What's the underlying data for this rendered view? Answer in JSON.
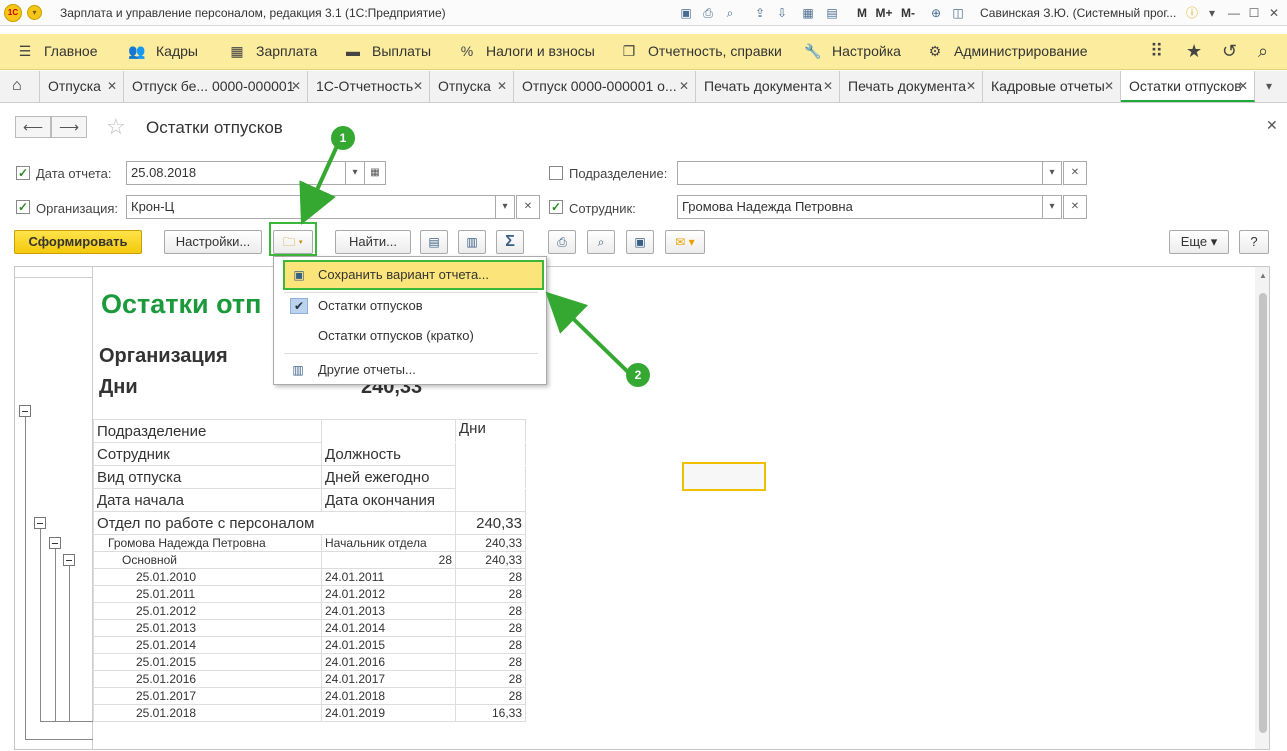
{
  "window": {
    "title": "Зарплата и управление персоналом, редакция 3.1  (1С:Предприятие)",
    "user": "Савинская З.Ю. (Системный прог..."
  },
  "menu": [
    {
      "icon": "hamburger-icon",
      "label": "Главное"
    },
    {
      "icon": "people-icon",
      "label": "Кадры"
    },
    {
      "icon": "calculator-icon",
      "label": "Зарплата"
    },
    {
      "icon": "wallet-icon",
      "label": "Выплаты"
    },
    {
      "icon": "percent-icon",
      "label": "Налоги и взносы"
    },
    {
      "icon": "documents-icon",
      "label": "Отчетность, справки"
    },
    {
      "icon": "wrench-icon",
      "label": "Настройка"
    },
    {
      "icon": "gear-icon",
      "label": "Администрирование"
    }
  ],
  "tabs": [
    {
      "label": "Отпуска"
    },
    {
      "label": "Отпуск бе... 0000-000001"
    },
    {
      "label": "1С-Отчетность"
    },
    {
      "label": "Отпуска"
    },
    {
      "label": "Отпуск 0000-000001 о..."
    },
    {
      "label": "Печать документа"
    },
    {
      "label": "Печать документа"
    },
    {
      "label": "Кадровые отчеты"
    },
    {
      "label": "Остатки отпусков"
    }
  ],
  "page": {
    "title": "Остатки отпусков"
  },
  "filters": {
    "date_label": "Дата отчета:",
    "date_value": "25.08.2018",
    "org_label": "Организация:",
    "org_value": "Крон-Ц",
    "dept_label": "Подразделение:",
    "dept_value": "",
    "emp_label": "Сотрудник:",
    "emp_value": "Громова Надежда Петровна"
  },
  "toolbar": {
    "generate": "Сформировать",
    "settings": "Настройки...",
    "find": "Найти...",
    "more": "Еще",
    "help": "?"
  },
  "dropdown": {
    "save_variant": "Сохранить вариант отчета...",
    "variant1": "Остатки отпусков",
    "variant2": "Остатки отпусков (кратко)",
    "other": "Другие отчеты..."
  },
  "annotations": {
    "badge1": "1",
    "badge2": "2"
  },
  "report": {
    "title": "Остатки отп",
    "org_label": "Организация",
    "days_label": "Дни",
    "days_value": "240,33",
    "headers": {
      "dept": "Подразделение",
      "days": "Дни",
      "employee": "Сотрудник",
      "position": "Должность",
      "leave_type": "Вид отпуска",
      "annual_days": "Дней ежегодно",
      "start": "Дата начала",
      "end": "Дата окончания"
    },
    "group": {
      "dept": "Отдел по работе с персоналом",
      "dept_days": "240,33",
      "employee": "Громова Надежда Петровна",
      "position": "Начальник отдела",
      "emp_days": "240,33",
      "leave_type": "Основной",
      "annual": "28",
      "leave_days": "240,33"
    },
    "rows": [
      {
        "start": "25.01.2010",
        "end": "24.01.2011",
        "days": "28"
      },
      {
        "start": "25.01.2011",
        "end": "24.01.2012",
        "days": "28"
      },
      {
        "start": "25.01.2012",
        "end": "24.01.2013",
        "days": "28"
      },
      {
        "start": "25.01.2013",
        "end": "24.01.2014",
        "days": "28"
      },
      {
        "start": "25.01.2014",
        "end": "24.01.2015",
        "days": "28"
      },
      {
        "start": "25.01.2015",
        "end": "24.01.2016",
        "days": "28"
      },
      {
        "start": "25.01.2016",
        "end": "24.01.2017",
        "days": "28"
      },
      {
        "start": "25.01.2017",
        "end": "24.01.2018",
        "days": "28"
      },
      {
        "start": "25.01.2018",
        "end": "24.01.2019",
        "days": "16,33"
      }
    ]
  },
  "colors": {
    "menu_bg": "#fbec9e",
    "accent_green": "#1a9a3a",
    "highlight": "#3bb83b",
    "button_yellow": "#f3c90c"
  }
}
